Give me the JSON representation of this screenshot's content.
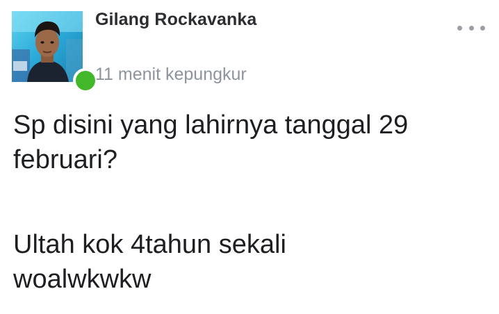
{
  "post": {
    "author_name": "Gilang Rockavanka",
    "timestamp": "11 menit kepungkur",
    "online_status_color": "#42b72a",
    "more_icon": "more-horizontal-icon",
    "paragraphs": [
      {
        "lines": [
          "Sp disini yang lahirnya tanggal 29",
          "februari?"
        ]
      },
      {
        "lines": [
          "Ultah kok 4tahun sekali",
          "woalwkwkw"
        ]
      }
    ]
  }
}
